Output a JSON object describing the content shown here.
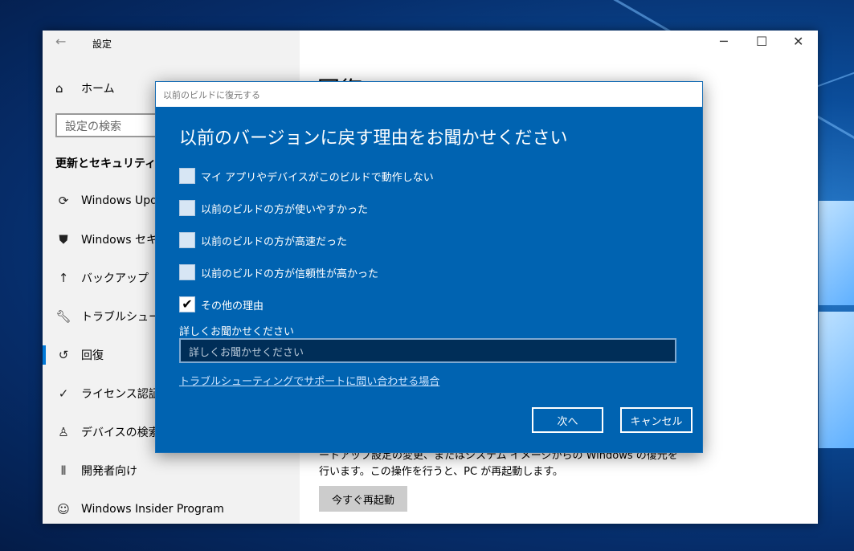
{
  "window": {
    "title": "設定",
    "controls": {
      "minimize": "─",
      "maximize": "☐",
      "close": "✕"
    }
  },
  "sidebar": {
    "home_label": "ホーム",
    "search_placeholder": "設定の検索",
    "section_title": "更新とセキュリティ",
    "items": [
      {
        "label": "Windows Upd",
        "icon": "sync-icon"
      },
      {
        "label": "Windows セキ",
        "icon": "shield-icon"
      },
      {
        "label": "バックアップ",
        "icon": "backup-arrow-icon"
      },
      {
        "label": "トラブルシューティ",
        "icon": "wrench-icon"
      },
      {
        "label": "回復",
        "icon": "history-icon",
        "active": true
      },
      {
        "label": "ライセンス認証",
        "icon": "check-circle-icon"
      },
      {
        "label": "デバイスの検索",
        "icon": "person-location-icon"
      },
      {
        "label": "開発者向け",
        "icon": "developer-tools-icon"
      },
      {
        "label": "Windows Insider Program",
        "icon": "insider-cat-icon"
      }
    ]
  },
  "main": {
    "title": "回復",
    "description": "ートアップ設定の変更、またはシステム イメージからの Windows の復元を行います。この操作を行うと、PC が再起動します。",
    "restart_button": "今すぐ再起動"
  },
  "dialog": {
    "title": "以前のビルドに復元する",
    "heading": "以前のバージョンに戻す理由をお聞かせください",
    "options": [
      {
        "label": "マイ アプリやデバイスがこのビルドで動作しない",
        "checked": false
      },
      {
        "label": "以前のビルドの方が使いやすかった",
        "checked": false
      },
      {
        "label": "以前のビルドの方が高速だった",
        "checked": false
      },
      {
        "label": "以前のビルドの方が信頼性が高かった",
        "checked": false
      },
      {
        "label": "その他の理由",
        "checked": true
      }
    ],
    "detail_label": "詳しくお聞かせください",
    "detail_placeholder": "詳しくお聞かせください",
    "support_link": "トラブルシューティングでサポートに問い合わせる場合",
    "next_button": "次へ",
    "cancel_button": "キャンセル"
  }
}
